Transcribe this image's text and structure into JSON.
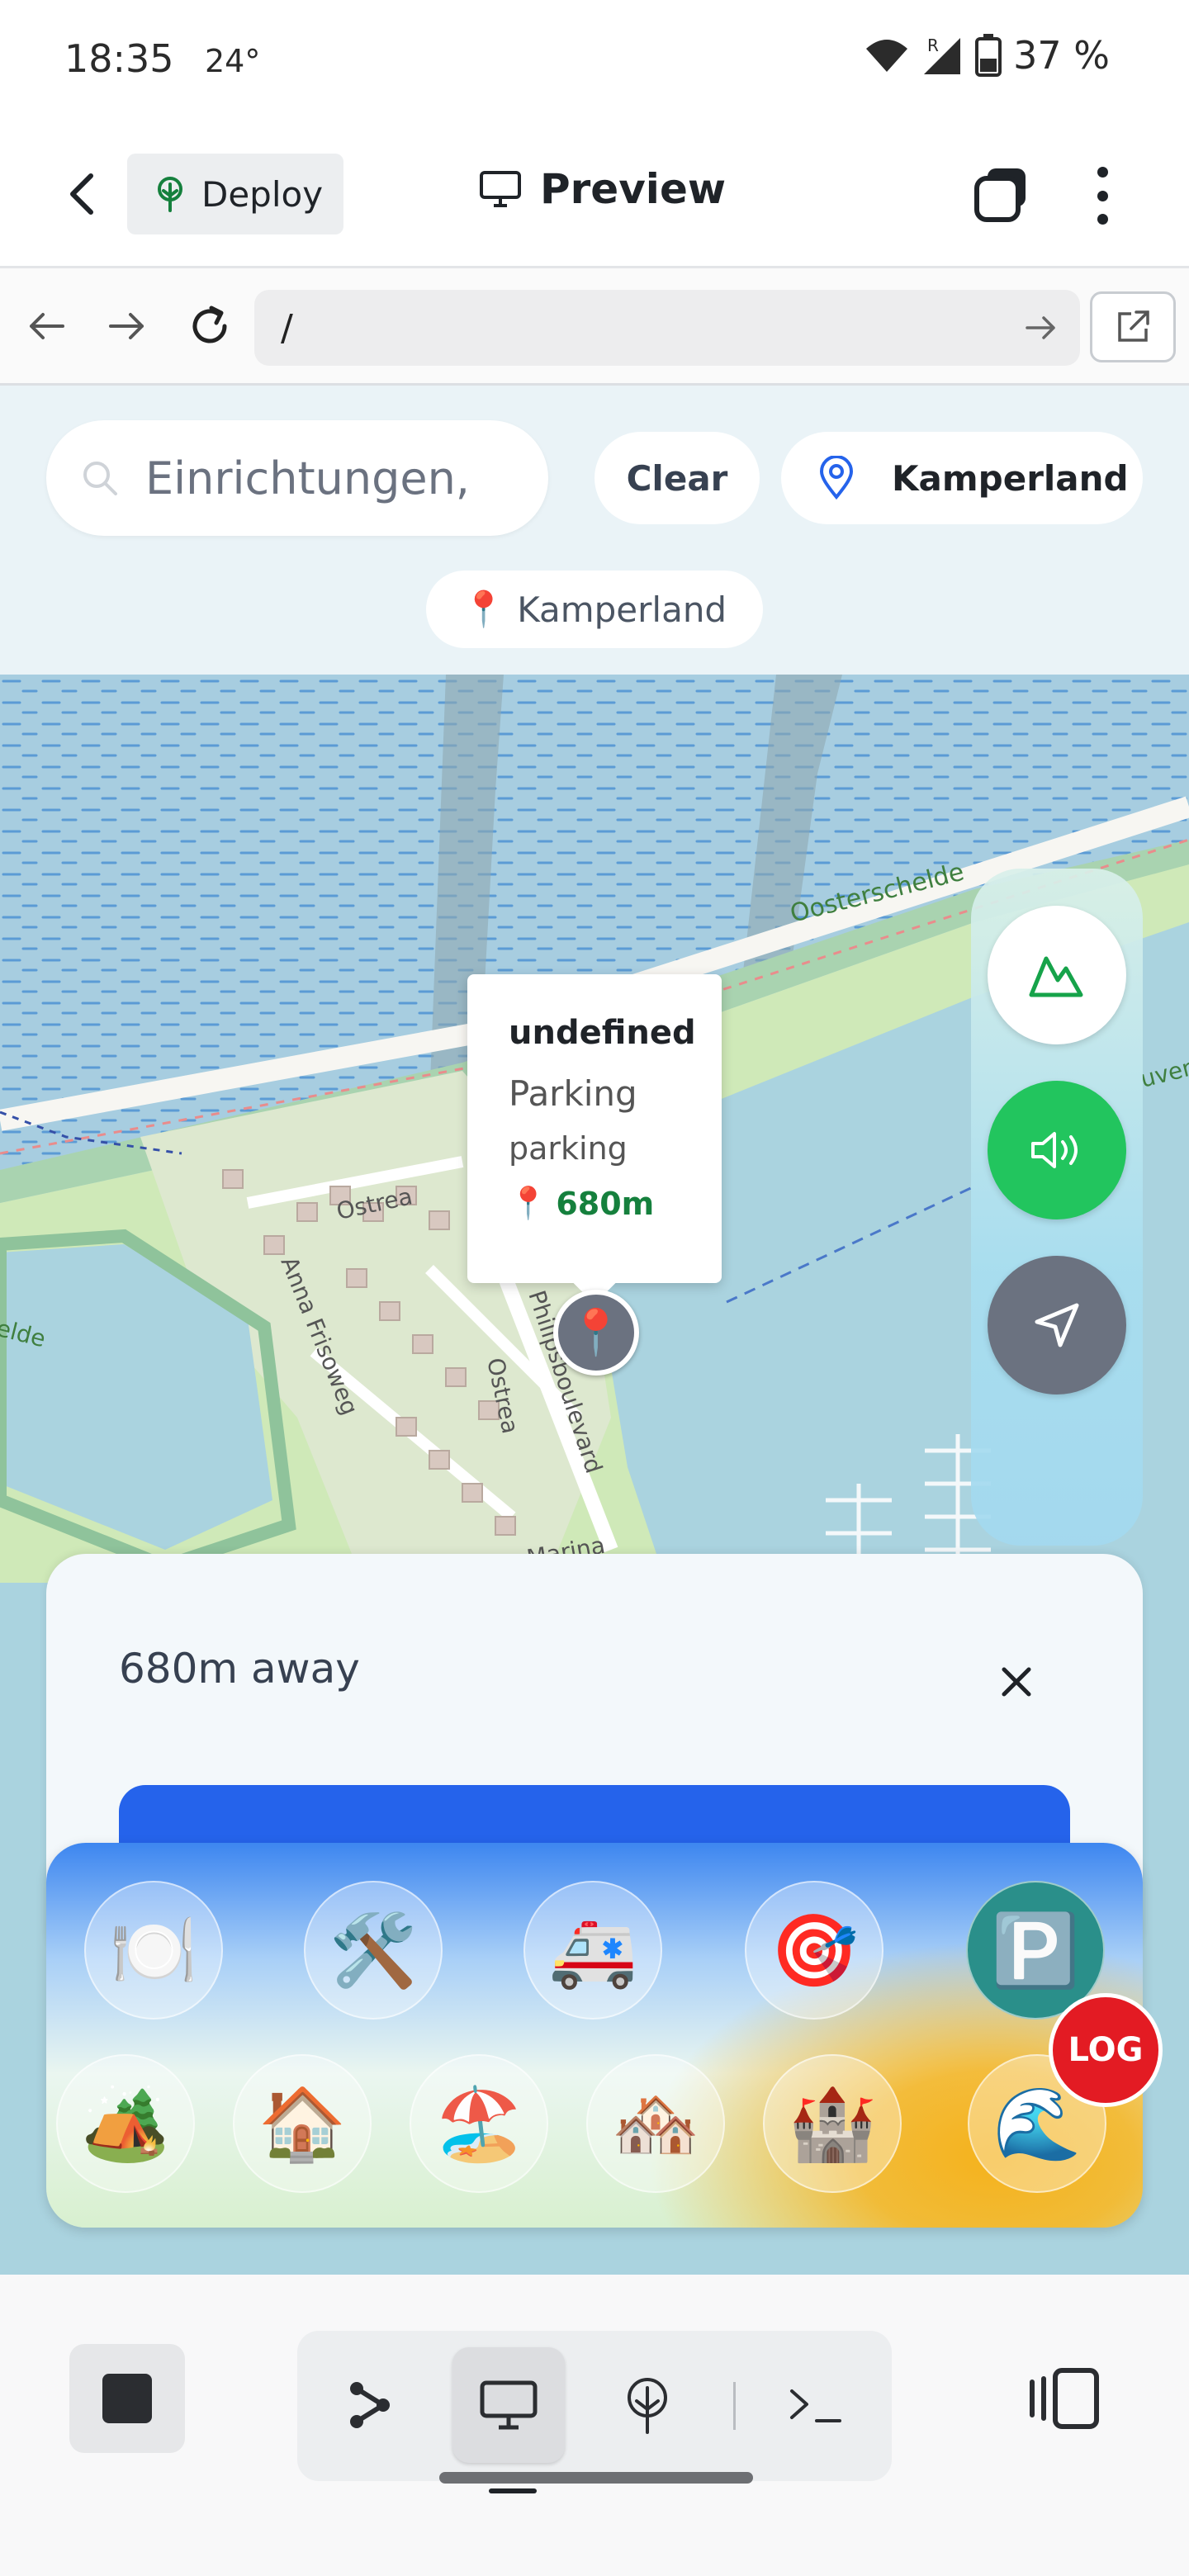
{
  "status_bar": {
    "time": "18:35",
    "temperature": "24°",
    "battery": "37 %",
    "network_badge": "R"
  },
  "app_header": {
    "deploy_label": "Deploy",
    "preview_label": "Preview"
  },
  "browser": {
    "url": "/"
  },
  "search": {
    "placeholder": "Einrichtungen,",
    "clear_label": "Clear",
    "location_label": "Kamperland",
    "location_chip": "Kamperland"
  },
  "map": {
    "labels": {
      "water": "Oosterschelde",
      "street_1": "Ostrea",
      "street_2": "Anna Frisoweg",
      "street_3": "Ostrea",
      "street_4": "Marina",
      "street_5": "Philipsboulevard",
      "edge_left": "elde",
      "edge_right": "uven"
    }
  },
  "popup": {
    "title": "undefined",
    "type": "Parking",
    "subtype": "parking",
    "distance": "680m"
  },
  "controls": {
    "terrain_icon": "mountain-icon",
    "sound_icon": "speaker-icon",
    "locate_icon": "navigation-arrow-icon",
    "sound_color": "#22c55e",
    "locate_color": "#6b7280"
  },
  "sheet": {
    "distance_text": "680m away",
    "navigate_color": "#2563eb"
  },
  "categories": {
    "row1": [
      "🍽️",
      "🛠️",
      "🚑",
      "🎯",
      "🅿️"
    ],
    "row2": [
      "🏕️",
      "🏠",
      "🏖️",
      "🏘️",
      "🏰",
      "🌊"
    ]
  },
  "log_badge": "LOG",
  "toolbar": {
    "prompt_symbol": ">_"
  }
}
